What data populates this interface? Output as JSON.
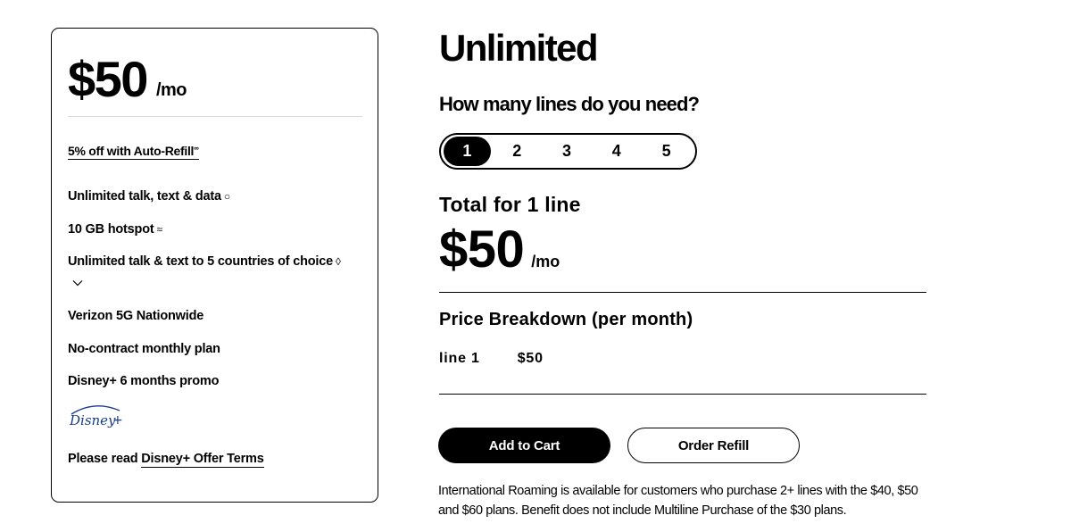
{
  "plan_card": {
    "price": "$50",
    "price_unit": "/mo",
    "auto_refill": "5% off with Auto-Refill",
    "auto_refill_mark": "∞",
    "features": [
      {
        "label": "Unlimited talk, text & data",
        "mark": "○"
      },
      {
        "label": "10 GB hotspot",
        "mark": "≈"
      },
      {
        "label": "Unlimited talk & text to 5 countries of choice",
        "mark": "◊"
      },
      {
        "label": "Verizon 5G Nationwide",
        "mark": ""
      },
      {
        "label": "No-contract monthly plan",
        "mark": ""
      },
      {
        "label": "Disney+ 6 months promo",
        "mark": ""
      }
    ],
    "disney_logo_text": "Disney+",
    "offer_terms_prefix": "Please read ",
    "offer_terms_link": "Disney+ Offer Terms"
  },
  "main": {
    "title": "Unlimited",
    "lines_question": "How many lines do you need?",
    "line_options": [
      "1",
      "2",
      "3",
      "4",
      "5"
    ],
    "selected_line": "1",
    "total_label": "Total for 1 line",
    "total_price": "$50",
    "total_unit": "/mo",
    "breakdown_title": "Price Breakdown (per month)",
    "breakdown_rows": [
      {
        "label": "line 1",
        "price": "$50"
      }
    ],
    "add_to_cart": "Add to Cart",
    "order_refill": "Order Refill",
    "roaming_note": "International Roaming is available for customers who purchase 2+ lines with the $40, $50 and $60 plans. Benefit does not include Multiline Purchase of the $30 plans."
  },
  "colors": {
    "accent": "#000000",
    "background": "#ffffff",
    "divider": "#d8dadc"
  }
}
